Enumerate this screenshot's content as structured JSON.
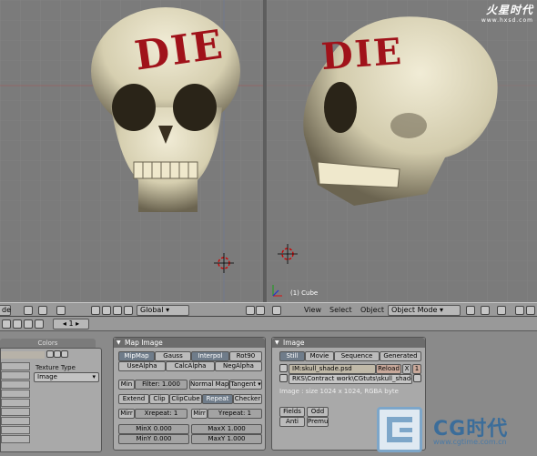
{
  "watermarks": {
    "top_logo": "火星时代",
    "top_url": "www.hxsd.com",
    "bottom_logo": "CG时代",
    "bottom_url": "www.cgtime.com.cn"
  },
  "viewports": {
    "left": {
      "skull_text": "DIE"
    },
    "right": {
      "skull_text": "DIE",
      "object_label": "(1) Cube"
    }
  },
  "header": {
    "left_mode_tail": "de",
    "orientation": "Global",
    "menus": [
      "View",
      "Select",
      "Object"
    ],
    "mode": "Object Mode"
  },
  "buttons_header": {
    "frame": "1"
  },
  "colors_panel": {
    "tab": "Colors",
    "texture_type_label": "Texture Type",
    "texture_type_value": "Image"
  },
  "map_image": {
    "title": "Map Image",
    "row1": [
      "MipMap",
      "Gauss",
      "Interpol",
      "Rot90"
    ],
    "row2": [
      "UseAlpha",
      "CalcAlpha",
      "NegAlpha"
    ],
    "min": "Min",
    "filter": "Filter: 1.000",
    "normal_map": "Normal Map",
    "tangent": "Tangent",
    "ext_row": [
      "Extend",
      "Clip",
      "ClipCube",
      "Repeat",
      "Checker"
    ],
    "mirr_x": "Mirr",
    "xrepeat": "Xrepeat: 1",
    "mirr_y": "Mirr",
    "yrepeat": "Yrepeat: 1",
    "minx": "MinX 0.000",
    "maxx": "MaxX 1.000",
    "miny": "MinY 0.000",
    "maxy": "MaxY 1.000"
  },
  "image": {
    "title": "Image",
    "tabs": [
      "Still",
      "Movie",
      "Sequence",
      "Generated"
    ],
    "name_field": "IM:skull_shade.psd",
    "reload": "Reload",
    "x": "X",
    "users": "1",
    "path": "RKS\\Contract work\\CGtuts\\skull_shade.psd",
    "info": "Image : size 1024 x 1024, RGBA byte",
    "fields": "Fields",
    "odd": "Odd",
    "anti": "Anti",
    "premul": "Premul"
  },
  "colors": {
    "active_button": "#6f7c8a",
    "blood": "#a0121a",
    "skull_light": "#e8e2c8",
    "skull_shadow": "#6b6450",
    "panel_bg": "#a9a9a9"
  }
}
